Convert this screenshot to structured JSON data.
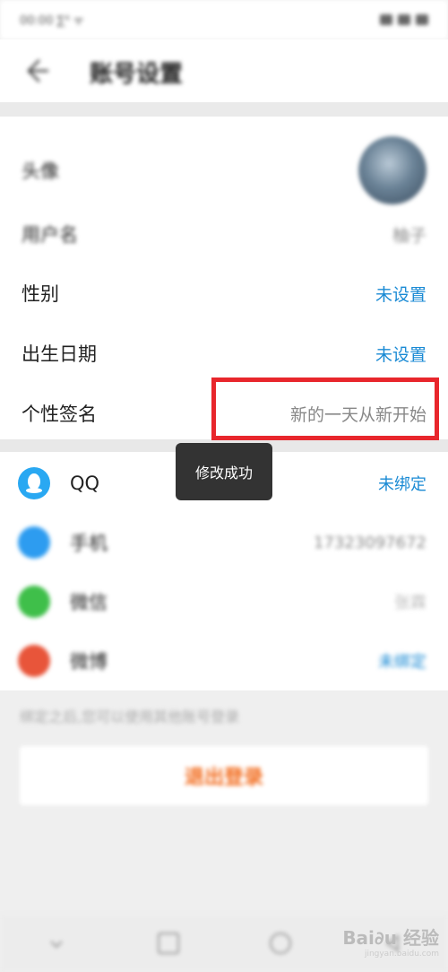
{
  "status_bar": {
    "time": "00:00 ∑⁴ ᯤ"
  },
  "header": {
    "title": "账号设置"
  },
  "profile": [
    {
      "label": "头像",
      "value": ""
    },
    {
      "label": "用户名",
      "value": "柚子"
    },
    {
      "label": "性别",
      "value": "未设置"
    },
    {
      "label": "出生日期",
      "value": "未设置"
    },
    {
      "label": "个性签名",
      "value": "新的一天从新开始"
    }
  ],
  "accounts": [
    {
      "label": "QQ",
      "value": "未绑定",
      "icon": "qq-icon",
      "color": "#29a8f2"
    },
    {
      "label": "手机",
      "value": "17323097672",
      "icon": "phone-icon",
      "color": "#2d9cf0"
    },
    {
      "label": "微信",
      "value": "张霖",
      "icon": "wechat-icon",
      "color": "#3fbf4a"
    },
    {
      "label": "微博",
      "value": "未绑定",
      "icon": "weibo-icon",
      "color": "#e8553a"
    }
  ],
  "hint": "绑定之后,您可以使用其他账号登录",
  "logout_label": "退出登录",
  "toast": "修改成功",
  "watermark": {
    "brand": "Bai∂u 经验",
    "url": "jingyan.baidu.com"
  },
  "colors": {
    "link": "#1a8ad4",
    "highlight": "#e8262c",
    "logout": "#f26a1b"
  }
}
